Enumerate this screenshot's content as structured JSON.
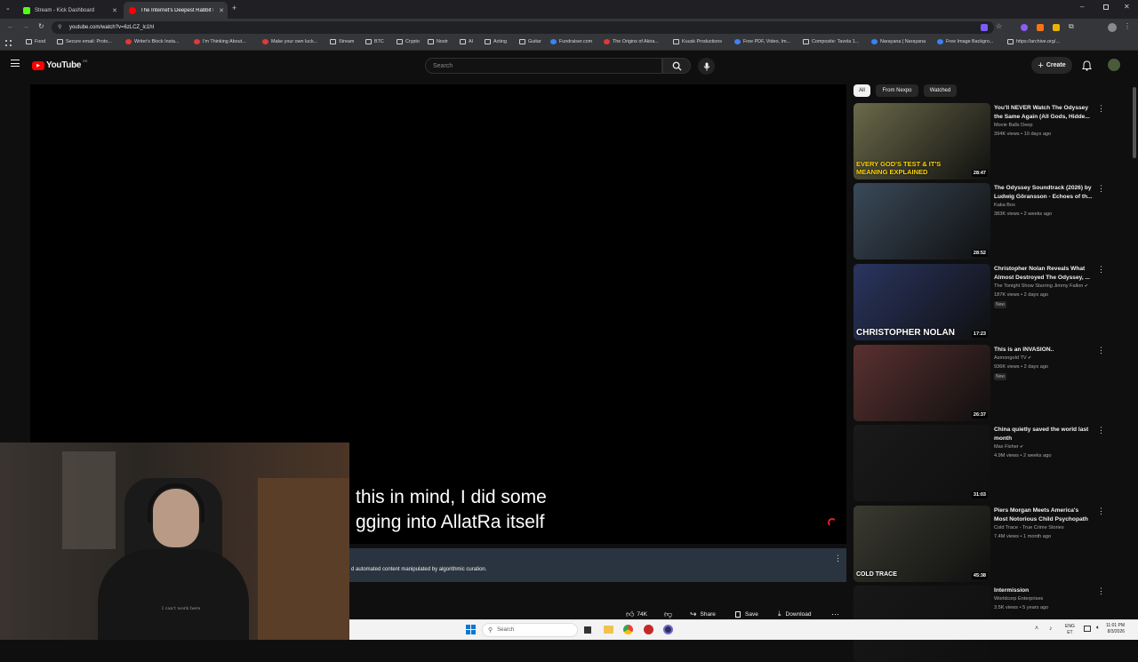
{
  "browser": {
    "tabs": [
      {
        "label": "Stream - Kick Dashboard",
        "color": "#53fc18"
      },
      {
        "label": "The Internet's Deepest Rabbit H",
        "color": "#ff0000"
      }
    ],
    "new_tab_label": "+",
    "url": "youtube.com/watch?v=6zLCZ_lc1hI",
    "bookmarks": [
      {
        "label": "Food",
        "icon": "folder-icon"
      },
      {
        "label": "Secure email: Proto...",
        "icon": "proton-icon"
      },
      {
        "label": "Writer's Block Insta...",
        "icon": "youtube-icon"
      },
      {
        "label": "I'm Thinking About...",
        "icon": "youtube-icon"
      },
      {
        "label": "Make your own luck...",
        "icon": "youtube-icon"
      },
      {
        "label": "Stream",
        "icon": "folder-icon"
      },
      {
        "label": "BTC",
        "icon": "folder-icon"
      },
      {
        "label": "Crypto",
        "icon": "folder-icon"
      },
      {
        "label": "Nostr",
        "icon": "folder-icon"
      },
      {
        "label": "AI",
        "icon": "folder-icon"
      },
      {
        "label": "Acting",
        "icon": "folder-icon"
      },
      {
        "label": "Guitar",
        "icon": "folder-icon"
      },
      {
        "label": "Fundraiser.com",
        "icon": "globe-icon"
      },
      {
        "label": "The Origins of Akira...",
        "icon": "youtube-icon"
      },
      {
        "label": "Kuusk Productions",
        "icon": "folder-icon"
      },
      {
        "label": "Free PDF, Video, Im...",
        "icon": "globe-icon"
      },
      {
        "label": "Composite: Tavola 1...",
        "icon": "grid-icon"
      },
      {
        "label": "Narayana | Narayana",
        "icon": "globe-icon"
      },
      {
        "label": "Free Image Backgro...",
        "icon": "globe-icon"
      },
      {
        "label": "https://archive.org/...",
        "icon": "archive-icon"
      }
    ]
  },
  "youtube": {
    "logo_text": "YouTube",
    "country": "EE",
    "search_placeholder": "Search",
    "create_label": "Create"
  },
  "player": {
    "caption_line1": "this in mind, I did some",
    "caption_line2": "gging into AllatRa itself",
    "info_text": "d automated content manipulated by algorithmic curation."
  },
  "actions": {
    "likes": "74K",
    "share": "Share",
    "save": "Save",
    "download": "Download"
  },
  "chips": [
    "All",
    "From Nexpo",
    "Watched"
  ],
  "recommendations": [
    {
      "title": "You'll NEVER Watch The Odyssey the Same Again (All Gods, Hidde...",
      "channel": "Movie Balls Deep",
      "meta": "394K views • 10 days ago",
      "duration": "28:47",
      "verified": false,
      "new": false,
      "thumb_text": "EVERY GOD'S TEST & IT'S MEANING EXPLAINED",
      "thumb_color": "#6b6a4a"
    },
    {
      "title": "The Odyssey Soundtrack (2026) by Ludwig Göransson - Echoes of th...",
      "channel": "Kaka Box",
      "meta": "383K views • 2 weeks ago",
      "duration": "28:52",
      "verified": false,
      "new": false,
      "thumb_text": "",
      "thumb_color": "#3a4a5a"
    },
    {
      "title": "Christopher Nolan Reveals What Almost Destroyed The Odyssey, ...",
      "channel": "The Tonight Show Starring Jimmy Fallon",
      "meta": "187K views • 2 days ago",
      "duration": "17:23",
      "verified": true,
      "new": true,
      "thumb_text": "CHRISTOPHER NOLAN",
      "thumb_color": "#2a3560"
    },
    {
      "title": "This is an INVASION..",
      "channel": "Asmongold TV",
      "meta": "936K views • 2 days ago",
      "duration": "26:37",
      "verified": true,
      "new": true,
      "thumb_text": "",
      "thumb_color": "#5a3030"
    },
    {
      "title": "China quietly saved the world last month",
      "channel": "Max Fisher",
      "meta": "4.9M views • 2 weeks ago",
      "duration": "31:03",
      "verified": true,
      "new": false,
      "thumb_text": "",
      "thumb_color": "#1a1a1a"
    },
    {
      "title": "Piers Morgan Meets America's Most Notorious Child Psychopath",
      "channel": "Cold Trace - True Crime Stories",
      "meta": "7.4M views • 1 month ago",
      "duration": "45:38",
      "verified": false,
      "new": false,
      "thumb_text": "COLD TRACE",
      "thumb_color": "#3a3a30"
    },
    {
      "title": "Intermission",
      "channel": "Worldcorp Enterprises",
      "meta": "3.5K views • 5 years ago",
      "duration": "",
      "verified": false,
      "new": false,
      "thumb_text": "",
      "thumb_color": "#181818"
    }
  ],
  "webcam": {
    "hoodie_text": "I can't work here"
  },
  "taskbar": {
    "search_placeholder": "Search",
    "lang_top": "ENG",
    "lang_bottom": "ET",
    "time": "11:01 PM",
    "date": "8/3/2026"
  }
}
